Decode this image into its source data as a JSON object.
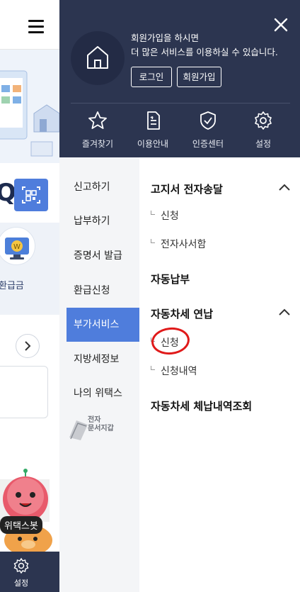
{
  "background": {
    "refund_label": "환급금",
    "bot_label": "위택스봇",
    "footer_settings_label": "설정"
  },
  "drawer": {
    "welcome_line1": "회원가입을 하시면",
    "welcome_line2": "더 많은 서비스를 이용하실 수 있습니다.",
    "login_label": "로그인",
    "join_label": "회원가입",
    "quick_links": [
      {
        "label": "즐겨찾기",
        "icon": "star-icon"
      },
      {
        "label": "이용안내",
        "icon": "document-icon"
      },
      {
        "label": "인증센터",
        "icon": "shield-check-icon"
      },
      {
        "label": "설정",
        "icon": "gear-icon"
      }
    ],
    "menu": [
      {
        "label": "신고하기"
      },
      {
        "label": "납부하기"
      },
      {
        "label": "증명서 발급"
      },
      {
        "label": "환급신청"
      },
      {
        "label": "부가서비스",
        "active": true
      },
      {
        "label": "지방세정보"
      },
      {
        "label": "나의 위택스"
      }
    ],
    "doc_wallet_line1": "전자",
    "doc_wallet_line2": "문서지갑",
    "submenu": [
      {
        "title": "고지서 전자송달",
        "expanded": true,
        "items": [
          "신청",
          "전자사서함"
        ]
      },
      {
        "title": "자동납부",
        "expanded": false,
        "items": []
      },
      {
        "title": "자동차세 연납",
        "expanded": true,
        "items": [
          "신청",
          "신청내역"
        ]
      },
      {
        "title": "자동차세 체납내역조회",
        "expanded": false,
        "items": []
      }
    ],
    "colors": {
      "header_bg": "#2c3550",
      "active_menu": "#4f7ddc",
      "menu_bg": "#f4f5f7",
      "annotation": "#e01a1a"
    }
  }
}
